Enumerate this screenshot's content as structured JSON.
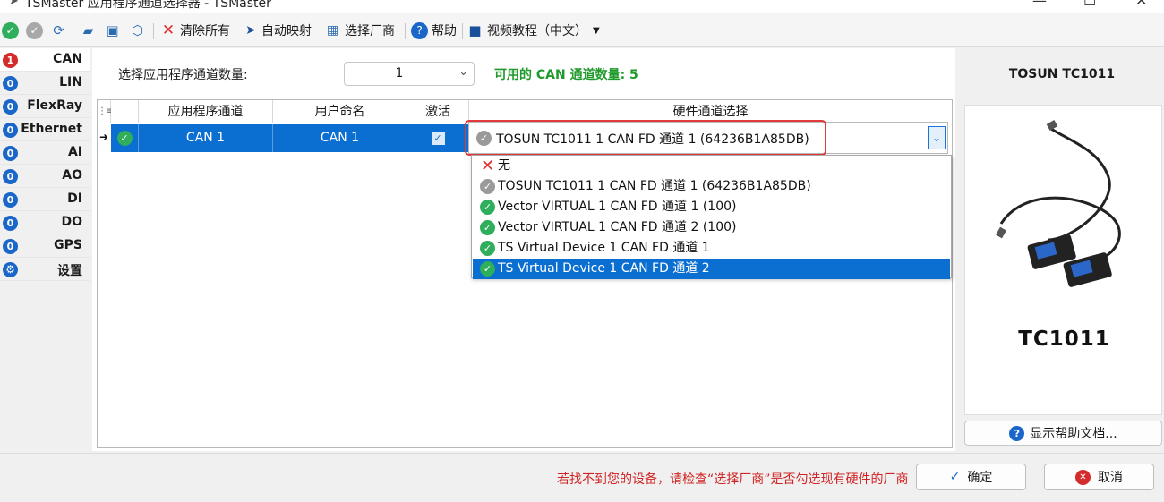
{
  "window": {
    "title": "TSMaster 应用程序通道选择器 - TSMaster"
  },
  "toolbar": {
    "clear_all": "清除所有",
    "auto_map": "自动映射",
    "select_vendor": "选择厂商",
    "help": "帮助",
    "video_tutorial": "视频教程（中文）"
  },
  "nav": [
    {
      "label": "CAN",
      "count": "1",
      "active": true
    },
    {
      "label": "LIN",
      "count": "0"
    },
    {
      "label": "FlexRay",
      "count": "0"
    },
    {
      "label": "Ethernet",
      "count": "0"
    },
    {
      "label": "AI",
      "count": "0"
    },
    {
      "label": "AO",
      "count": "0"
    },
    {
      "label": "DI",
      "count": "0"
    },
    {
      "label": "DO",
      "count": "0"
    },
    {
      "label": "GPS",
      "count": "0"
    },
    {
      "label": "设置"
    }
  ],
  "main": {
    "count_label": "选择应用程序通道数量:",
    "count_value": "1",
    "available": "可用的 CAN 通道数量: 5"
  },
  "grid": {
    "headers": [
      "应用程序通道",
      "用户命名",
      "激活",
      "硬件通道选择"
    ],
    "rows": [
      {
        "app_channel": "CAN 1",
        "user_name": "CAN 1",
        "active": true,
        "hardware": "TOSUN TC1011 1 CAN FD 通道 1 (64236B1A85DB)"
      }
    ]
  },
  "dropdown": {
    "options": [
      {
        "label": "无",
        "icon": "x-icon"
      },
      {
        "label": "TOSUN TC1011 1 CAN FD 通道 1 (64236B1A85DB)",
        "icon": "gray-check-icon"
      },
      {
        "label": "Vector VIRTUAL 1 CAN FD 通道 1 (100)",
        "icon": "green-check-icon"
      },
      {
        "label": "Vector VIRTUAL 1 CAN FD 通道 2 (100)",
        "icon": "green-check-icon"
      },
      {
        "label": "TS Virtual Device 1 CAN FD 通道 1",
        "icon": "green-check-icon"
      },
      {
        "label": "TS Virtual Device 1 CAN FD 通道 2",
        "icon": "green-check-icon",
        "highlighted": true
      }
    ]
  },
  "right": {
    "device_title": "TOSUN TC1011",
    "device_caption": "TC1011",
    "help_doc": "显示帮助文档..."
  },
  "bottom": {
    "hint": "若找不到您的设备，请检查“选择厂商”是否勾选现有硬件的厂商",
    "ok": "确定",
    "cancel": "取消"
  },
  "colors": {
    "accent": "#0a6fd1",
    "green": "#1f9a2a",
    "red": "#d02424"
  }
}
